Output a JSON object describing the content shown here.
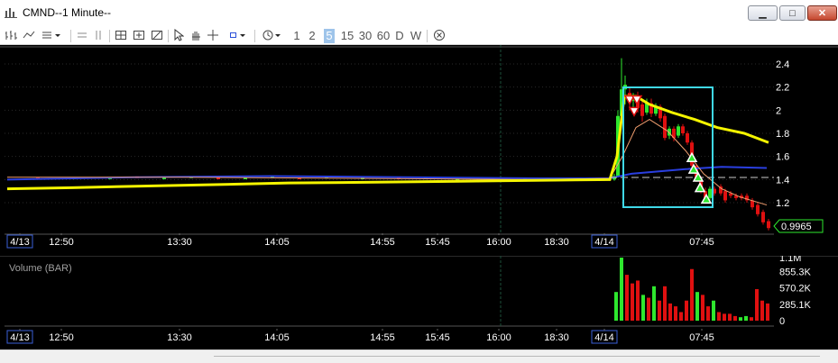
{
  "window": {
    "title": "CMND--1 Minute--",
    "controls": {
      "minimize": "▭",
      "maximize": "□",
      "close": "✕"
    }
  },
  "toolbar": {
    "periods": [
      "1",
      "2",
      "5",
      "15",
      "30",
      "60",
      "D",
      "W"
    ],
    "selected_period": "5",
    "icons": [
      "bar-style-icon",
      "line-style-icon",
      "study-menu-icon",
      "horizontal-line-icon",
      "vertical-line-icon",
      "zoom-in-icon",
      "zoom-out-icon",
      "pointer-icon",
      "hand-icon",
      "crosshair-icon",
      "box-icon",
      "clock-icon",
      "close-circle-icon"
    ]
  },
  "price_pane": {
    "y_labels": [
      "2.4",
      "2.2",
      "2",
      "1.8",
      "1.6",
      "1.4",
      "1.2"
    ],
    "last_price": "0.9965",
    "x_labels": [
      "4/13",
      "12:50",
      "13:30",
      "14:05",
      "14:55",
      "15:45",
      "16:00",
      "18:30",
      "4/14",
      "07:45"
    ]
  },
  "volume_pane": {
    "title": "Volume (BAR)",
    "y_labels": [
      "1.1M",
      "855.3K",
      "570.2K",
      "285.1K",
      "0"
    ],
    "x_labels": [
      "4/13",
      "12:50",
      "13:30",
      "14:05",
      "14:55",
      "15:45",
      "16:00",
      "18:30",
      "4/14",
      "07:45"
    ]
  },
  "colors": {
    "up": "#2ee82e",
    "down": "#e01010",
    "ma_yellow": "#f4f400",
    "ma_blue": "#2a3fe0",
    "ma_salmon": "#f4a070",
    "selection_box": "#3fd9e8",
    "date_highlight": "#3a5fd8"
  }
}
